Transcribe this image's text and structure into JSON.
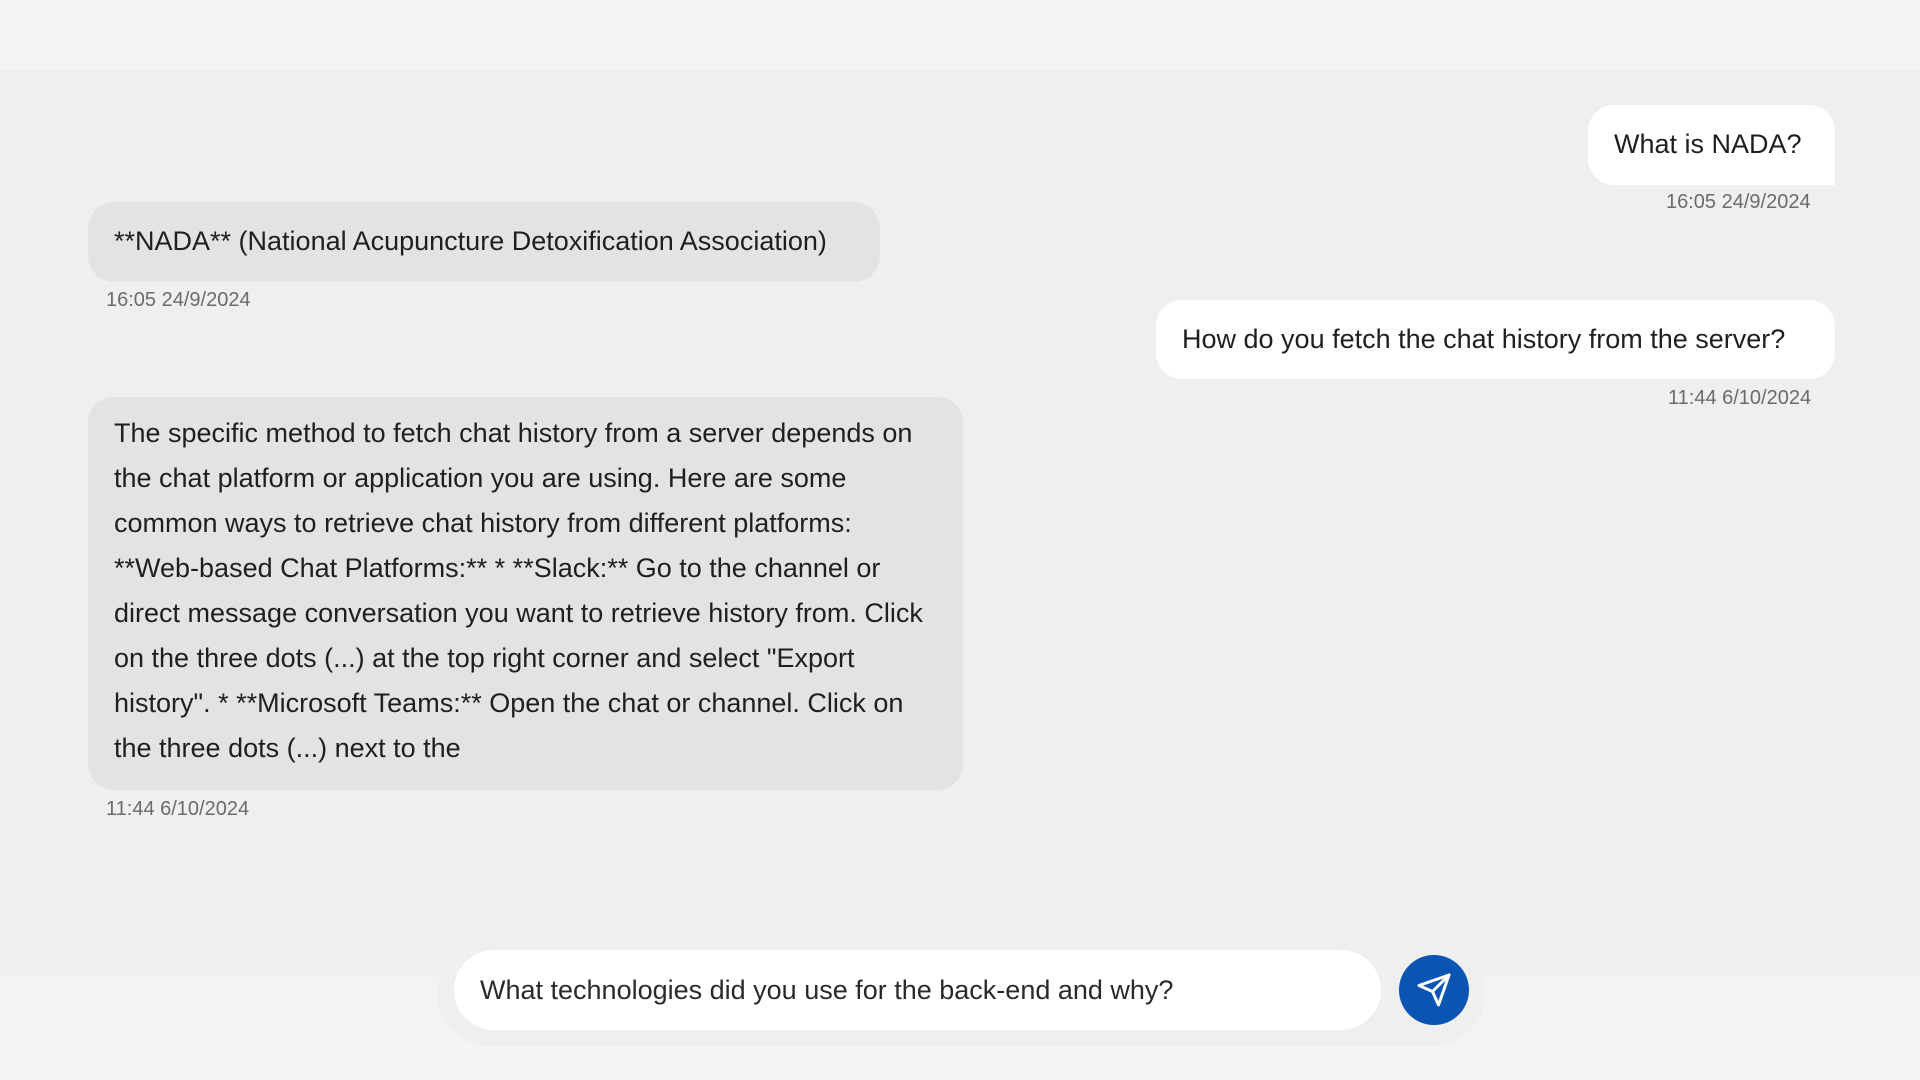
{
  "messages": [
    {
      "role": "user",
      "text": "What is NADA?",
      "time": "16:05 24/9/2024"
    },
    {
      "role": "bot",
      "text": "**NADA** (National Acupuncture Detoxification Association)",
      "time": "16:05 24/9/2024"
    },
    {
      "role": "user",
      "text": "How do you fetch the chat history from the server?",
      "time": "11:44 6/10/2024"
    },
    {
      "role": "bot",
      "text": "The specific method to fetch chat history from a server depends on the chat platform or application you are using. Here are some common ways to retrieve chat history from different platforms: **Web-based Chat Platforms:** * **Slack:** Go to the channel or direct message conversation you want to retrieve history from. Click on the three dots (...) at the top right corner and select \"Export history\". * **Microsoft Teams:** Open the chat or channel. Click on the three dots (...) next to the",
      "time": "11:44 6/10/2024"
    }
  ],
  "composer": {
    "value": "What technologies did you use for the back-end and why?",
    "send_icon": "send-icon"
  },
  "colors": {
    "send_button": "#0a54b4",
    "user_bubble": "#ffffff",
    "bot_bubble": "#e3e3e3"
  }
}
